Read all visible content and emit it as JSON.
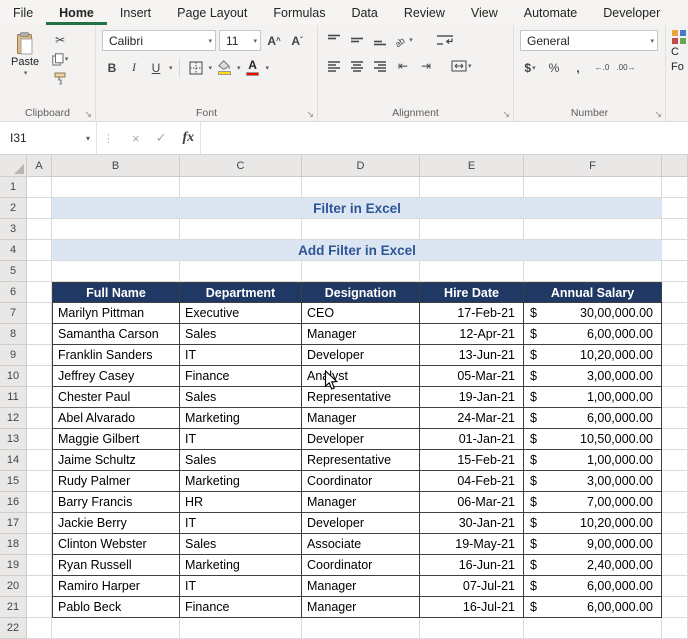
{
  "colors": {
    "accent_green": "#217346",
    "table_header_bg": "#1f3864",
    "table_header_text": "#ffffff",
    "title_bg": "#dce6f2",
    "title_text": "#2e5596",
    "fill_color_swatch": "#ffe000",
    "font_color_swatch": "#ff0000"
  },
  "ribbon": {
    "tabs": [
      "File",
      "Home",
      "Insert",
      "Page Layout",
      "Formulas",
      "Data",
      "Review",
      "View",
      "Automate",
      "Developer"
    ],
    "active_tab": "Home",
    "clipboard": {
      "label": "Clipboard",
      "paste_label": "Paste"
    },
    "font": {
      "label": "Font",
      "font_name": "Calibri",
      "font_size": "11",
      "bold": "B",
      "italic": "I",
      "underline": "U"
    },
    "alignment": {
      "label": "Alignment"
    },
    "number": {
      "label": "Number",
      "format": "General",
      "currency": "$",
      "percent": "%",
      "comma": ",",
      "increase_decimal": "←.0",
      "decrease_decimal": ".00→"
    },
    "styles_partial": {
      "line1": "C",
      "line2": "Fo"
    }
  },
  "formula_bar": {
    "name_box": "I31",
    "fx_label": "fx",
    "value": ""
  },
  "sheet": {
    "col_letters": [
      "A",
      "B",
      "C",
      "D",
      "E",
      "F"
    ],
    "num_rows": 22,
    "title_row2": "Filter in Excel",
    "title_row4": "Add Filter in Excel",
    "table_headers": [
      "Full Name",
      "Department",
      "Designation",
      "Hire Date",
      "Annual Salary"
    ],
    "currency": "$",
    "records": [
      {
        "name": "Marilyn Pittman",
        "dept": "Executive",
        "desig": "CEO",
        "hire": "17-Feb-21",
        "salary": "30,00,000.00"
      },
      {
        "name": "Samantha Carson",
        "dept": "Sales",
        "desig": "Manager",
        "hire": "12-Apr-21",
        "salary": "6,00,000.00"
      },
      {
        "name": "Franklin Sanders",
        "dept": "IT",
        "desig": "Developer",
        "hire": "13-Jun-21",
        "salary": "10,20,000.00"
      },
      {
        "name": "Jeffrey Casey",
        "dept": "Finance",
        "desig": "Analyst",
        "hire": "05-Mar-21",
        "salary": "3,00,000.00"
      },
      {
        "name": "Chester Paul",
        "dept": "Sales",
        "desig": "Representative",
        "hire": "19-Jan-21",
        "salary": "1,00,000.00"
      },
      {
        "name": "Abel Alvarado",
        "dept": "Marketing",
        "desig": "Manager",
        "hire": "24-Mar-21",
        "salary": "6,00,000.00"
      },
      {
        "name": "Maggie Gilbert",
        "dept": "IT",
        "desig": "Developer",
        "hire": "01-Jan-21",
        "salary": "10,50,000.00"
      },
      {
        "name": "Jaime Schultz",
        "dept": "Sales",
        "desig": "Representative",
        "hire": "15-Feb-21",
        "salary": "1,00,000.00"
      },
      {
        "name": "Rudy Palmer",
        "dept": "Marketing",
        "desig": "Coordinator",
        "hire": "04-Feb-21",
        "salary": "3,00,000.00"
      },
      {
        "name": "Barry Francis",
        "dept": "HR",
        "desig": "Manager",
        "hire": "06-Mar-21",
        "salary": "7,00,000.00"
      },
      {
        "name": "Jackie Berry",
        "dept": "IT",
        "desig": "Developer",
        "hire": "30-Jan-21",
        "salary": "10,20,000.00"
      },
      {
        "name": "Clinton Webster",
        "dept": "Sales",
        "desig": "Associate",
        "hire": "19-May-21",
        "salary": "9,00,000.00"
      },
      {
        "name": "Ryan Russell",
        "dept": "Marketing",
        "desig": "Coordinator",
        "hire": "16-Jun-21",
        "salary": "2,40,000.00"
      },
      {
        "name": "Ramiro Harper",
        "dept": "IT",
        "desig": "Manager",
        "hire": "07-Jul-21",
        "salary": "6,00,000.00"
      },
      {
        "name": "Pablo Beck",
        "dept": "Finance",
        "desig": "Manager",
        "hire": "16-Jul-21",
        "salary": "6,00,000.00"
      }
    ]
  }
}
